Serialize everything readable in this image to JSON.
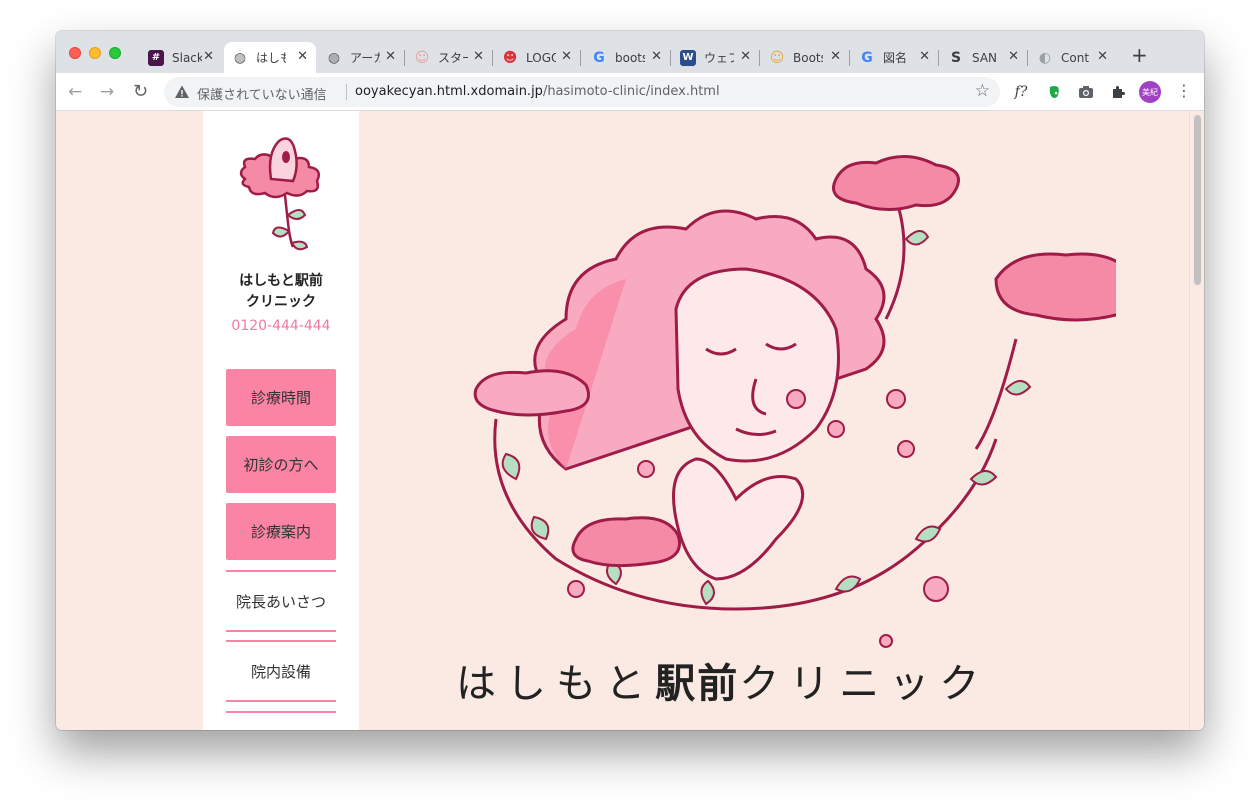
{
  "browser": {
    "tabs": [
      {
        "title": "Slack",
        "favicon": "slack-icon",
        "fav_text": "#",
        "fav_color": "#4a154b",
        "active": false
      },
      {
        "title": "はしもと駅前クリニック",
        "favicon": "globe-icon",
        "fav_text": "◍",
        "fav_color": "#5f6368",
        "active": true
      },
      {
        "title": "アーカイブ",
        "favicon": "globe-icon",
        "fav_text": "◍",
        "fav_color": "#5f6368",
        "active": false
      },
      {
        "title": "スター",
        "favicon": "star-face-icon",
        "fav_text": "☺",
        "fav_color": "#e8a0a0",
        "active": false
      },
      {
        "title": "LOGO",
        "favicon": "logo-face-icon",
        "fav_text": "☻",
        "fav_color": "#d9383b",
        "active": false
      },
      {
        "title": "bootstrap",
        "favicon": "google-icon",
        "fav_text": "G",
        "fav_color": "#4285f4",
        "active": false
      },
      {
        "title": "ウェブ",
        "favicon": "wp-icon",
        "fav_text": "W",
        "fav_color": "#2b4d8c",
        "active": false
      },
      {
        "title": "Bootstrap",
        "favicon": "character-icon",
        "fav_text": "☺",
        "fav_color": "#e7a83b",
        "active": false
      },
      {
        "title": "図名",
        "favicon": "google-icon",
        "fav_text": "G",
        "fav_color": "#4285f4",
        "active": false
      },
      {
        "title": "SAN",
        "favicon": "san-icon",
        "fav_text": "S",
        "fav_color": "#3c4043",
        "active": false
      },
      {
        "title": "Cont",
        "favicon": "eye-icon",
        "fav_text": "◐",
        "fav_color": "#9aa0a6",
        "active": false
      }
    ],
    "security_label": "保護されていない通信",
    "url_host": "ooyakecyan.html.xdomain.jp",
    "url_path": "/hasimoto-clinic/index.html",
    "profile_initials": "美紀"
  },
  "site": {
    "clinic_name_line1": "はしもと駅前",
    "clinic_name_line2": "クリニック",
    "phone": "0120-444-444",
    "menu": {
      "btn_hours": "診療時間",
      "btn_first_visit": "初診の方へ",
      "btn_guide": "診療案内",
      "link_greeting": "院長あいさつ",
      "link_facilities": "院内設備"
    },
    "hero_title_prefix": "はしもと",
    "hero_title_bold": "駅前",
    "hero_title_suffix": "クリニック"
  },
  "colors": {
    "accent_pink": "#fb83a4",
    "phone_pink": "#f07aa0",
    "page_bg": "#faeae3",
    "illustration_stroke": "#a01c48",
    "leaf_green": "#b5dfc0"
  }
}
